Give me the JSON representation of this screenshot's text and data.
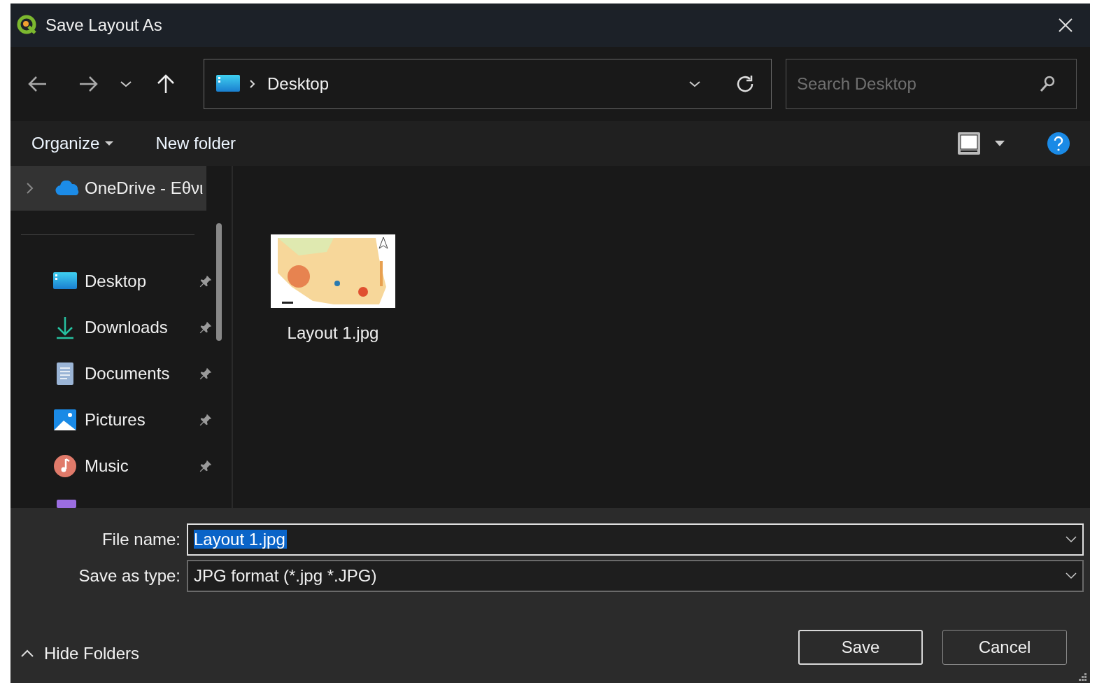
{
  "window": {
    "title": "Save Layout As"
  },
  "address_bar": {
    "location": "Desktop"
  },
  "search": {
    "placeholder": "Search Desktop"
  },
  "command_bar": {
    "organize": "Organize",
    "new_folder": "New folder"
  },
  "tree": {
    "label": "OneDrive - Εθνι",
    "selected": true,
    "expanded": false
  },
  "quick_access": [
    {
      "label": "Desktop",
      "kind": "desktop",
      "pinned": true
    },
    {
      "label": "Downloads",
      "kind": "downloads",
      "pinned": true
    },
    {
      "label": "Documents",
      "kind": "documents",
      "pinned": true
    },
    {
      "label": "Pictures",
      "kind": "pictures",
      "pinned": true
    },
    {
      "label": "Music",
      "kind": "music",
      "pinned": true
    }
  ],
  "files": [
    {
      "name": "Layout 1.jpg",
      "selected": false
    }
  ],
  "file_name": {
    "label": "File name:",
    "value": "Layout 1.jpg"
  },
  "save_as_type": {
    "label": "Save as type:",
    "value": "JPG format (*.jpg *.JPG)"
  },
  "hide_folders": "Hide Folders",
  "buttons": [
    {
      "label": "Save",
      "kind": "primary"
    },
    {
      "label": "Cancel",
      "kind": "secondary"
    }
  ]
}
